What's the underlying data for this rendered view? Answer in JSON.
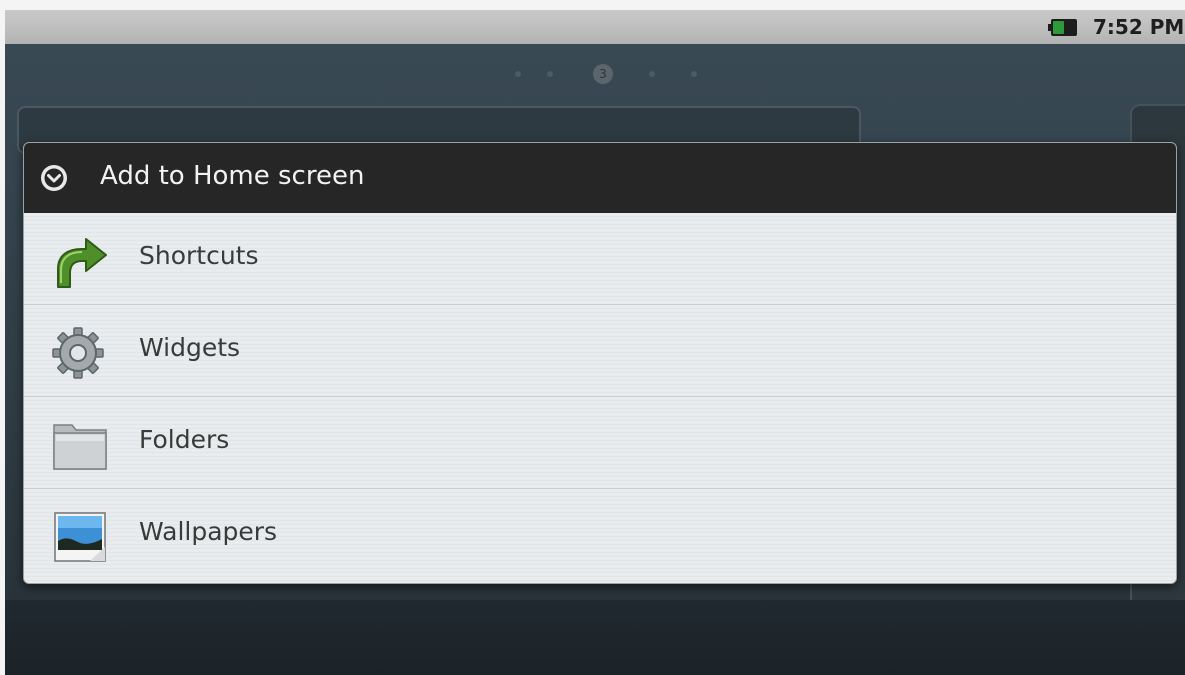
{
  "status_bar": {
    "time": "7:52 PM",
    "battery_level": 0.5,
    "battery_color": "#2f9a3a",
    "battery_icon": "battery-icon"
  },
  "home_screen": {
    "current_page": "3"
  },
  "dialog": {
    "title": "Add to Home screen",
    "header_icon": "chevron-down-circle-icon",
    "items": [
      {
        "label": "Shortcuts",
        "icon": "shortcut-arrow-icon"
      },
      {
        "label": "Widgets",
        "icon": "gear-icon"
      },
      {
        "label": "Folders",
        "icon": "folder-icon"
      },
      {
        "label": "Wallpapers",
        "icon": "wallpaper-picture-icon"
      }
    ]
  }
}
